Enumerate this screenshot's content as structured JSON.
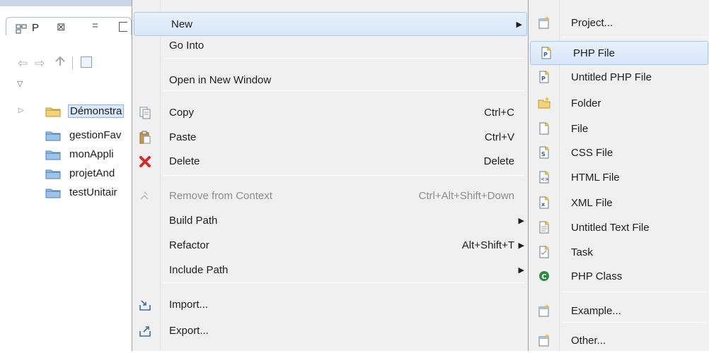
{
  "explorer": {
    "tab_label": "P",
    "tab_close": "⊠",
    "tab_minimize": "=",
    "tree": [
      {
        "label": "Démonstra",
        "expandable": true,
        "selected": true
      },
      {
        "label": "gestionFav",
        "expandable": false,
        "selected": false
      },
      {
        "label": "monAppli",
        "expandable": false,
        "selected": false
      },
      {
        "label": "projetAnd",
        "expandable": false,
        "selected": false
      },
      {
        "label": "testUnitair",
        "expandable": false,
        "selected": false
      }
    ]
  },
  "context_menu": {
    "items": [
      {
        "label": "New",
        "shortcut": "",
        "submenu": true,
        "disabled": false,
        "icon": ""
      },
      {
        "label": "Go Into",
        "shortcut": "",
        "submenu": false,
        "disabled": false,
        "icon": ""
      },
      {
        "label": "Open in New Window",
        "shortcut": "",
        "submenu": false,
        "disabled": false,
        "icon": ""
      },
      {
        "label": "Copy",
        "shortcut": "Ctrl+C",
        "submenu": false,
        "disabled": false,
        "icon": "copy-icon"
      },
      {
        "label": "Paste",
        "shortcut": "Ctrl+V",
        "submenu": false,
        "disabled": false,
        "icon": "paste-icon"
      },
      {
        "label": "Delete",
        "shortcut": "Delete",
        "submenu": false,
        "disabled": false,
        "icon": "delete-icon"
      },
      {
        "label": "Remove from Context",
        "shortcut": "Ctrl+Alt+Shift+Down",
        "submenu": false,
        "disabled": true,
        "icon": "remove-context-icon"
      },
      {
        "label": "Build Path",
        "shortcut": "",
        "submenu": true,
        "disabled": false,
        "icon": ""
      },
      {
        "label": "Refactor",
        "shortcut": "Alt+Shift+T",
        "submenu": true,
        "disabled": false,
        "icon": ""
      },
      {
        "label": "Include Path",
        "shortcut": "",
        "submenu": true,
        "disabled": false,
        "icon": ""
      },
      {
        "label": "Import...",
        "shortcut": "",
        "submenu": false,
        "disabled": false,
        "icon": "import-icon"
      },
      {
        "label": "Export...",
        "shortcut": "",
        "submenu": false,
        "disabled": false,
        "icon": "export-icon"
      }
    ]
  },
  "new_submenu": {
    "items": [
      {
        "label": "Project...",
        "icon": "new-project-icon"
      },
      {
        "label": "PHP File",
        "icon": "php-file-icon"
      },
      {
        "label": "Untitled PHP File",
        "icon": "php-file-icon"
      },
      {
        "label": "Folder",
        "icon": "new-folder-icon"
      },
      {
        "label": "File",
        "icon": "new-file-icon"
      },
      {
        "label": "CSS File",
        "icon": "css-file-icon"
      },
      {
        "label": "HTML File",
        "icon": "html-file-icon"
      },
      {
        "label": "XML File",
        "icon": "xml-file-icon"
      },
      {
        "label": "Untitled Text File",
        "icon": "text-file-icon"
      },
      {
        "label": "Task",
        "icon": "task-icon"
      },
      {
        "label": "PHP Class",
        "icon": "php-class-icon"
      },
      {
        "label": "Example...",
        "icon": "example-icon"
      },
      {
        "label": "Other...",
        "icon": "other-wizard-icon"
      }
    ]
  },
  "colors": {
    "menu_bg": "#f0f0f0",
    "highlight": "#d6e6f8",
    "folder": "#9cc3e8",
    "delete_red": "#d42a2a",
    "class_green": "#2e8b3e"
  }
}
